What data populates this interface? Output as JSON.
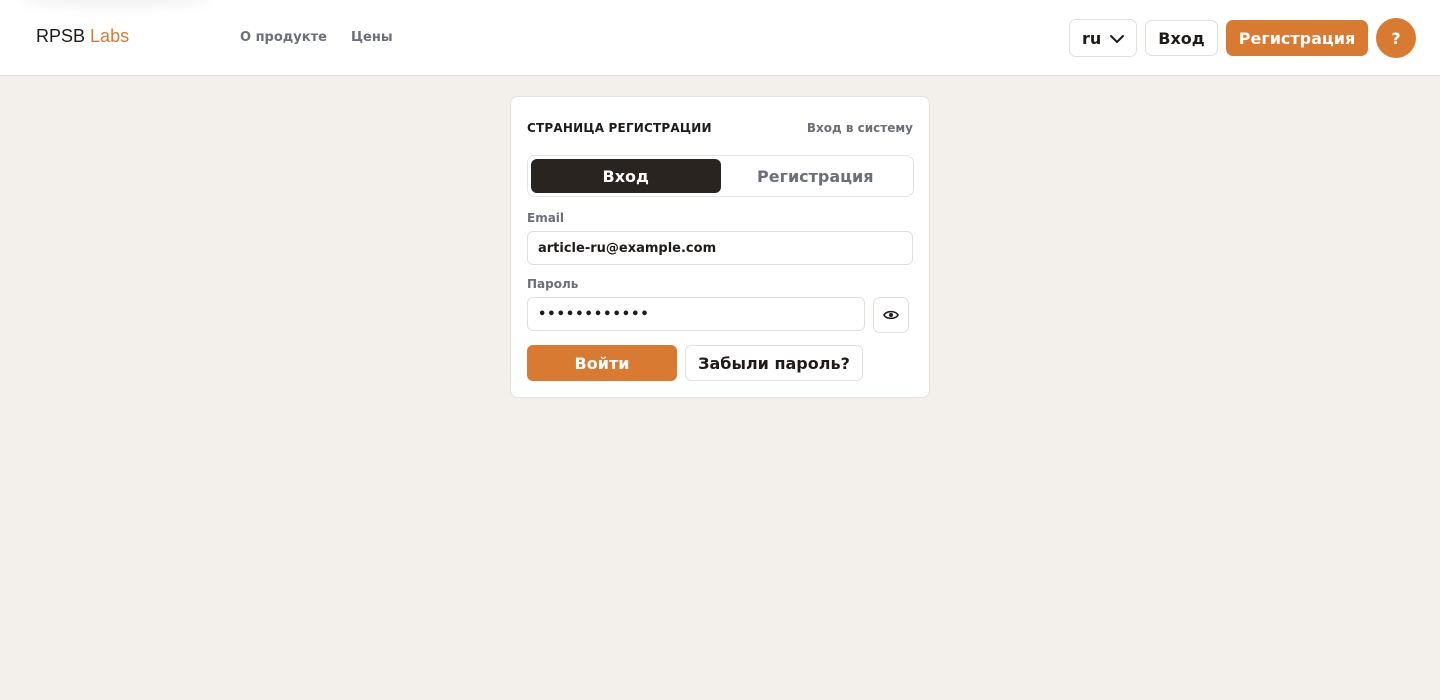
{
  "header": {
    "logo_main": "RPSB",
    "logo_accent": "Labs",
    "nav": [
      {
        "label": "О продукте"
      },
      {
        "label": "Цены"
      }
    ],
    "language": "ru",
    "login_label": "Вход",
    "register_label": "Регистрация",
    "help_label": "?"
  },
  "auth_card": {
    "title": "СТРАНИЦА РЕГИСТРАЦИИ",
    "subtitle": "Вход в систему",
    "tabs": [
      {
        "label": "Вход",
        "active": true
      },
      {
        "label": "Регистрация",
        "active": false
      }
    ],
    "email": {
      "label": "Email",
      "value": "article-ru@example.com"
    },
    "password": {
      "label": "Пароль",
      "value": "••••••••••••"
    },
    "submit_label": "Войти",
    "forgot_label": "Забыли пароль?"
  },
  "colors": {
    "accent": "#d97a32",
    "background": "#f3f0eb",
    "active_tab": "#2a2420"
  },
  "icons": {
    "language": "chevron-down-icon",
    "show_password": "eye-icon"
  }
}
